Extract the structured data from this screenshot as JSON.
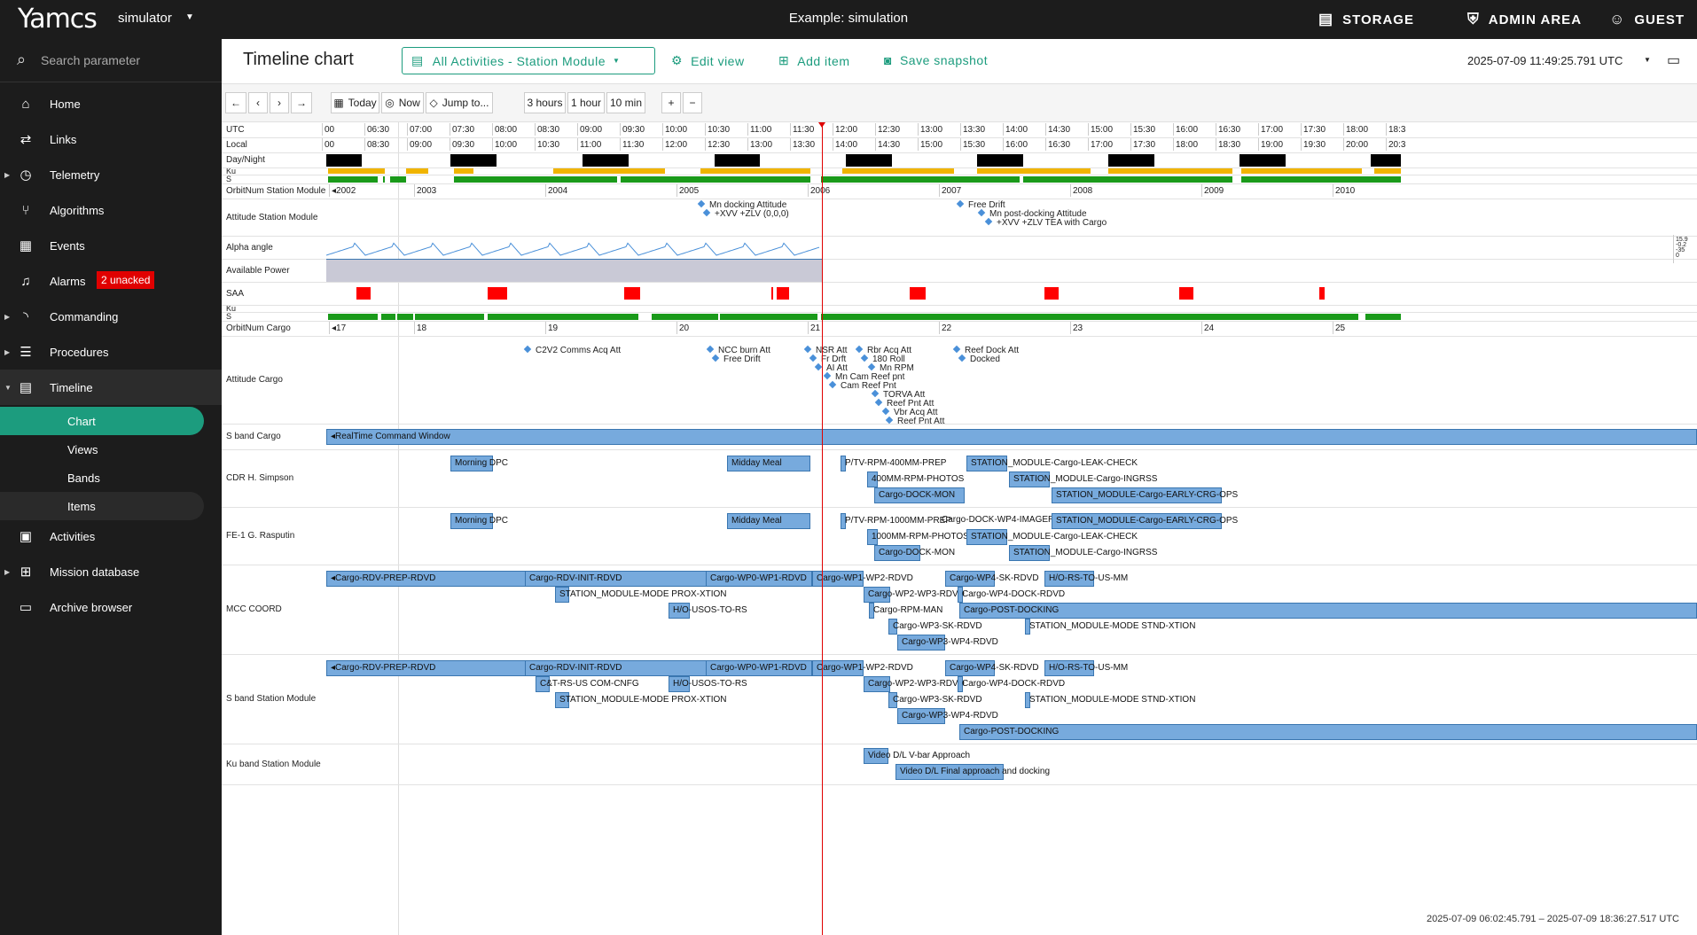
{
  "app": {
    "logo": "Yamcs",
    "instance": "simulator",
    "title": "Example: simulation"
  },
  "topbar": {
    "storage": "STORAGE",
    "admin": "ADMIN AREA",
    "user": "GUEST"
  },
  "search": {
    "placeholder": "Search parameter"
  },
  "nav": {
    "home": "Home",
    "links": "Links",
    "telemetry": "Telemetry",
    "algorithms": "Algorithms",
    "events": "Events",
    "alarms": "Alarms",
    "alarms_badge": "2 unacked",
    "commanding": "Commanding",
    "procedures": "Procedures",
    "timeline": "Timeline",
    "chart": "Chart",
    "views": "Views",
    "bands": "Bands",
    "items": "Items",
    "activities": "Activities",
    "mission_database": "Mission database",
    "archive_browser": "Archive browser"
  },
  "header": {
    "page_title": "Timeline chart",
    "view": "All Activities - Station Module",
    "edit_view": "Edit view",
    "add_item": "Add item",
    "save_snapshot": "Save snapshot",
    "timestamp": "2025-07-09 11:49:25.791 UTC"
  },
  "toolbar": {
    "today": "Today",
    "now": "Now",
    "jump": "Jump to...",
    "h3": "3 hours",
    "h1": "1 hour",
    "m10": "10 min",
    "plus": "+",
    "minus": "−"
  },
  "timeline": {
    "labels": {
      "utc": "UTC",
      "local": "Local",
      "daynight": "Day/Night",
      "ku": "Ku",
      "s": "S",
      "orbit_station": "OrbitNum Station Module",
      "attitude_station": "Attitude Station Module",
      "alpha": "Alpha angle",
      "power": "Available Power",
      "saa": "SAA",
      "ku2": "Ku",
      "s2": "S",
      "orbit_cargo": "OrbitNum Cargo",
      "attitude_cargo": "Attitude Cargo",
      "sband_cargo": "S band Cargo",
      "cdr": "CDR H. Simpson",
      "fe1": "FE-1 G. Rasputin",
      "mcc": "MCC COORD",
      "sband_station": "S band Station Module",
      "kuband_station": "Ku band Station Module"
    },
    "utc_ticks": [
      "00",
      "06:30",
      "07:00",
      "07:30",
      "08:00",
      "08:30",
      "09:00",
      "09:30",
      "10:00",
      "10:30",
      "11:00",
      "11:30",
      "12:00",
      "12:30",
      "13:00",
      "13:30",
      "14:00",
      "14:30",
      "15:00",
      "15:30",
      "16:00",
      "16:30",
      "17:00",
      "17:30",
      "18:00",
      "18:3"
    ],
    "local_ticks": [
      "00",
      "08:30",
      "09:00",
      "09:30",
      "10:00",
      "10:30",
      "11:00",
      "11:30",
      "12:00",
      "12:30",
      "13:00",
      "13:30",
      "14:00",
      "14:30",
      "15:00",
      "15:30",
      "16:00",
      "16:30",
      "17:00",
      "17:30",
      "18:00",
      "18:30",
      "19:00",
      "19:30",
      "20:00",
      "20:3"
    ],
    "orbit_station": [
      "◂2002",
      "2003",
      "2004",
      "2005",
      "2006",
      "2007",
      "2008",
      "2009",
      "2010"
    ],
    "orbit_cargo": [
      "◂17",
      "18",
      "19",
      "20",
      "21",
      "22",
      "23",
      "24",
      "25"
    ],
    "alpha_scale": [
      "15.9",
      "-0.2",
      "-35",
      "0"
    ],
    "range": "2025-07-09 06:02:45.791 – 2025-07-09 18:36:27.517 UTC",
    "attitude_station": [
      "Mn docking Attitude",
      "+XVV +ZLV (0,0,0)",
      "Free Drift",
      "Mn post-docking Attitude",
      "+XVV +ZLV TEA with Cargo"
    ],
    "attitude_cargo": [
      "C2V2 Comms Acq Att",
      "NCC burn Att",
      "Free Drift",
      "NSR Att",
      "Fr Drft",
      "AI Att",
      "Mn Cam Reef pnt",
      "Cam Reef Pnt",
      "Rbr Acq Att",
      "180 Roll",
      "Mn RPM",
      "TORVA Att",
      "Reef Pnt Att",
      "Vbr Acq Att",
      "Reef Pnt Att",
      "Reef Dock Att",
      "Docked"
    ],
    "sband_cargo": [
      "◂RealTime Command Window"
    ],
    "cdr": [
      "Morning DPC",
      "Midday Meal",
      "P/TV-RPM-400MM-PREP",
      "400MM-RPM-PHOTOS",
      "Cargo-DOCK-MON",
      "STATION_MODULE-Cargo-LEAK-CHECK",
      "STATION_MODULE-Cargo-INGRSS",
      "STATION_MODULE-Cargo-EARLY-CRG-OPS"
    ],
    "fe1": [
      "Morning DPC",
      "Midday Meal",
      "P/TV-RPM-1000MM-PREP",
      "1000MM-RPM-PHOTOS",
      "Cargo-DOCK-MON",
      "Cargo-DOCK-WP4-IMAGERY",
      "STATION_MODULE-Cargo-LEAK-CHECK",
      "STATION_MODULE-Cargo-INGRSS",
      "STATION_MODULE-Cargo-EARLY-CRG-OPS"
    ],
    "mcc": [
      "◂Cargo-RDV-PREP-RDVD",
      "Cargo-RDV-INIT-RDVD",
      "Cargo-WP0-WP1-RDVD",
      "Cargo-WP1-WP2-RDVD",
      "Cargo-WP4-SK-RDVD",
      "H/O-RS-TO-US-MM",
      "STATION_MODULE-MODE PROX-XTION",
      "Cargo-WP2-WP3-RDVD",
      "Cargo-WP4-DOCK-RDVD",
      "H/O-USOS-TO-RS",
      "Cargo-RPM-MAN",
      "Cargo-POST-DOCKING",
      "Cargo-WP3-SK-RDVD",
      "STATION_MODULE-MODE STND-XTION",
      "Cargo-WP3-WP4-RDVD"
    ],
    "sband_station": [
      "◂Cargo-RDV-PREP-RDVD",
      "Cargo-RDV-INIT-RDVD",
      "Cargo-WP0-WP1-RDVD",
      "Cargo-WP1-WP2-RDVD",
      "Cargo-WP4-SK-RDVD",
      "H/O-RS-TO-US-MM",
      "C&T-RS-US COM-CNFG",
      "H/O-USOS-TO-RS",
      "Cargo-WP2-WP3-RDVD",
      "Cargo-WP4-DOCK-RDVD",
      "STATION_MODULE-MODE PROX-XTION",
      "Cargo-WP3-SK-RDVD",
      "STATION_MODULE-MODE STND-XTION",
      "Cargo-WP3-WP4-RDVD",
      "Cargo-POST-DOCKING"
    ],
    "kuband_station": [
      "Video D/L V-bar Approach",
      "Video D/L Final approach and docking"
    ]
  },
  "colors": {
    "accent": "#1c9c7e",
    "dark": "#1c1c1c",
    "bar": "#77aadd",
    "ku": "#f0b400",
    "s": "#1a9a1a",
    "saa": "#ff0000",
    "now": "#e00000"
  }
}
